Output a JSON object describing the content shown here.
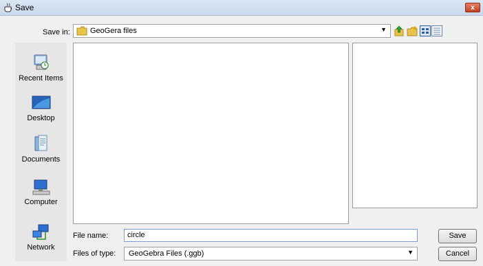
{
  "window": {
    "title": "Save",
    "close_label": "x"
  },
  "save_in": {
    "label": "Save in:",
    "value": "GeoGera files"
  },
  "toolbar": {
    "icons": [
      "up-folder-icon",
      "new-folder-icon",
      "list-view-icon",
      "details-view-icon"
    ]
  },
  "places": [
    {
      "label": "Recent Items",
      "icon": "recent-items-icon"
    },
    {
      "label": "Desktop",
      "icon": "desktop-icon"
    },
    {
      "label": "Documents",
      "icon": "documents-icon"
    },
    {
      "label": "Computer",
      "icon": "computer-icon"
    },
    {
      "label": "Network",
      "icon": "network-icon"
    }
  ],
  "file_name": {
    "label": "File name:",
    "value": "circle"
  },
  "file_type": {
    "label": "Files of type:",
    "value": "GeoGebra Files (.ggb)"
  },
  "buttons": {
    "save": "Save",
    "cancel": "Cancel"
  }
}
